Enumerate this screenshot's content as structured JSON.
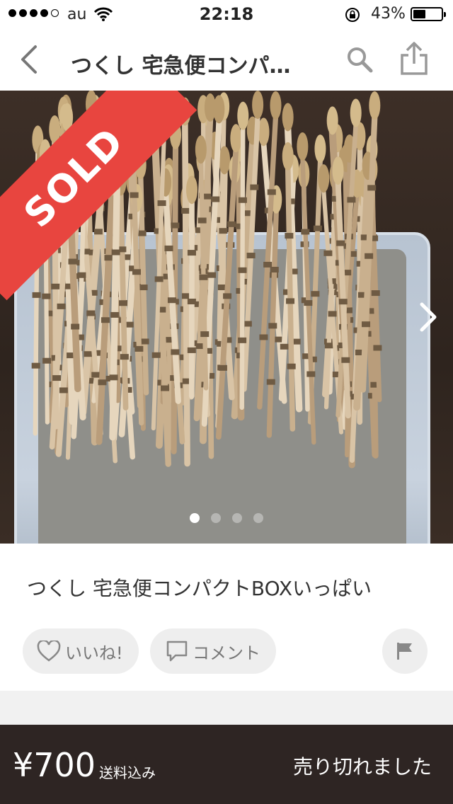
{
  "status_bar": {
    "carrier": "au",
    "time": "22:18",
    "battery_percent": "43%",
    "signal_bars_filled": 4,
    "signal_bars_total": 5,
    "battery_level": 0.43
  },
  "nav": {
    "title": "つくし 宅急便コンパ…",
    "icons": [
      "chevron-left-icon",
      "search-icon",
      "share-icon"
    ]
  },
  "photo": {
    "badge": "SOLD",
    "page_count": 4,
    "active_page": 1,
    "badge_color": "#e8453f"
  },
  "item": {
    "name": "つくし 宅急便コンパクトBOXいっぱい",
    "like_label": "いいね!",
    "comment_label": "コメント"
  },
  "footer": {
    "price": "¥700",
    "shipping": "送料込み",
    "status": "売り切れました",
    "background_color": "#2e2523"
  }
}
